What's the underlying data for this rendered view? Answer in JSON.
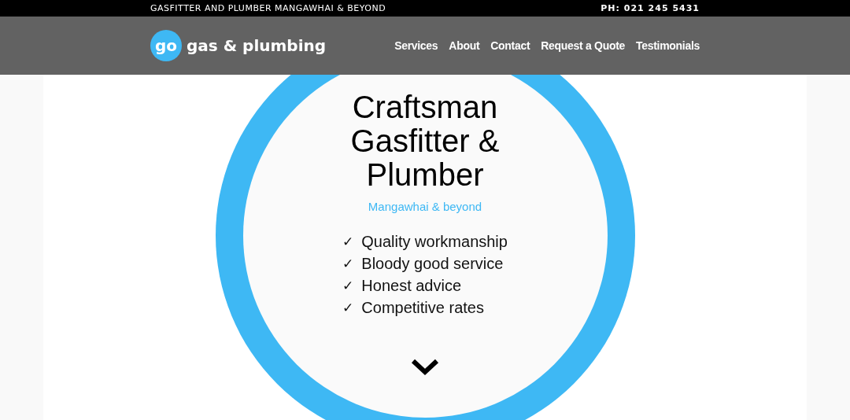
{
  "top_bar": {
    "tagline": "GASFITTER AND PLUMBER MANGAWHAI & BEYOND",
    "phone": "PH: 021 245 5431"
  },
  "header": {
    "logo_mark": "go",
    "logo_text": "gas & plumbing",
    "nav": [
      "Services",
      "About",
      "Contact",
      "Request a Quote",
      "Testimonials"
    ]
  },
  "hero": {
    "title_lines": [
      "Craftsman",
      "Gasfitter &",
      "Plumber"
    ],
    "subtitle": "Mangawhai & beyond",
    "features": [
      {
        "mark": "✓",
        "text": "Quality workmanship"
      },
      {
        "mark": "✓",
        "text": "Bloody good service"
      },
      {
        "mark": "✓",
        "text": "Honest advice"
      },
      {
        "mark": "✓",
        "text": "Competitive rates"
      }
    ]
  }
}
